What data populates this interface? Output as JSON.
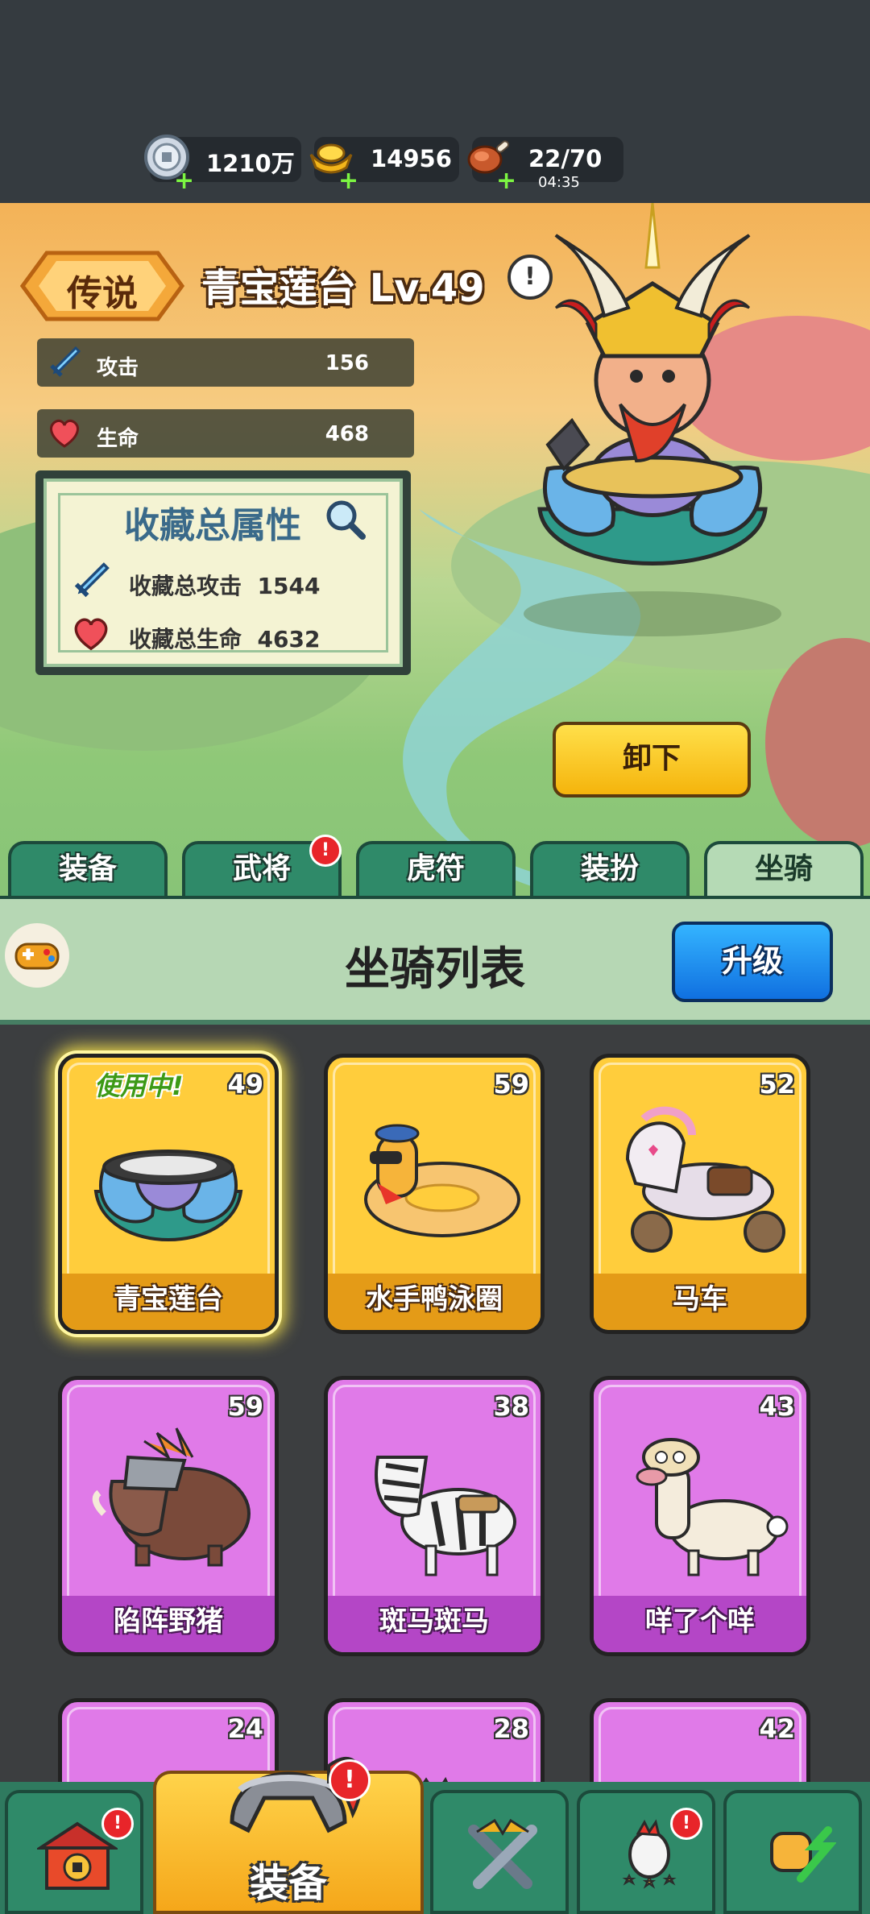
{
  "resources": {
    "silver": {
      "value": "1210万",
      "icon": "silver-coin-icon"
    },
    "gold": {
      "value": "14956",
      "icon": "gold-ingot-icon"
    },
    "stamina": {
      "value": "22/70",
      "timer": "04:35",
      "icon": "meat-icon"
    }
  },
  "mount": {
    "rarity": "传说",
    "title": "青宝莲台 Lv.49",
    "info_icon": "!",
    "stats": [
      {
        "label": "攻击",
        "value": "156",
        "icon": "sword-icon"
      },
      {
        "label": "生命",
        "value": "468",
        "icon": "heart-icon"
      }
    ],
    "unequip_label": "卸下"
  },
  "collection": {
    "title": "收藏总属性",
    "attack_label": "收藏总攻击",
    "attack_value": "1544",
    "hp_label": "收藏总生命",
    "hp_value": "4632"
  },
  "tabs": [
    {
      "label": "装备",
      "active": false
    },
    {
      "label": "武将",
      "active": false,
      "badge": "!"
    },
    {
      "label": "虎符",
      "active": false
    },
    {
      "label": "装扮",
      "active": false
    },
    {
      "label": "坐骑",
      "active": true
    }
  ],
  "list": {
    "title": "坐骑列表",
    "upgrade_label": "升级"
  },
  "cards": [
    {
      "name": "青宝莲台",
      "level": "49",
      "rarity": "gold",
      "status": "使用中!"
    },
    {
      "name": "水手鸭泳圈",
      "level": "59",
      "rarity": "gold"
    },
    {
      "name": "马车",
      "level": "52",
      "rarity": "gold"
    },
    {
      "name": "陷阵野猪",
      "level": "59",
      "rarity": "purple"
    },
    {
      "name": "斑马斑马",
      "level": "38",
      "rarity": "purple"
    },
    {
      "name": "咩了个咩",
      "level": "43",
      "rarity": "purple"
    },
    {
      "level": "24",
      "rarity": "purple"
    },
    {
      "level": "28",
      "rarity": "purple"
    },
    {
      "level": "42",
      "rarity": "purple"
    }
  ],
  "nav": {
    "main_label": "装备",
    "badge": "!"
  },
  "colors": {
    "tab_green": "#2f8a69",
    "active_tab": "#b5dab5",
    "gold_card": "#ffcd3c",
    "purple_card": "#e07ae8",
    "upgrade_blue": "#1e8ff0",
    "unequip_yellow": "#ffd21e"
  }
}
